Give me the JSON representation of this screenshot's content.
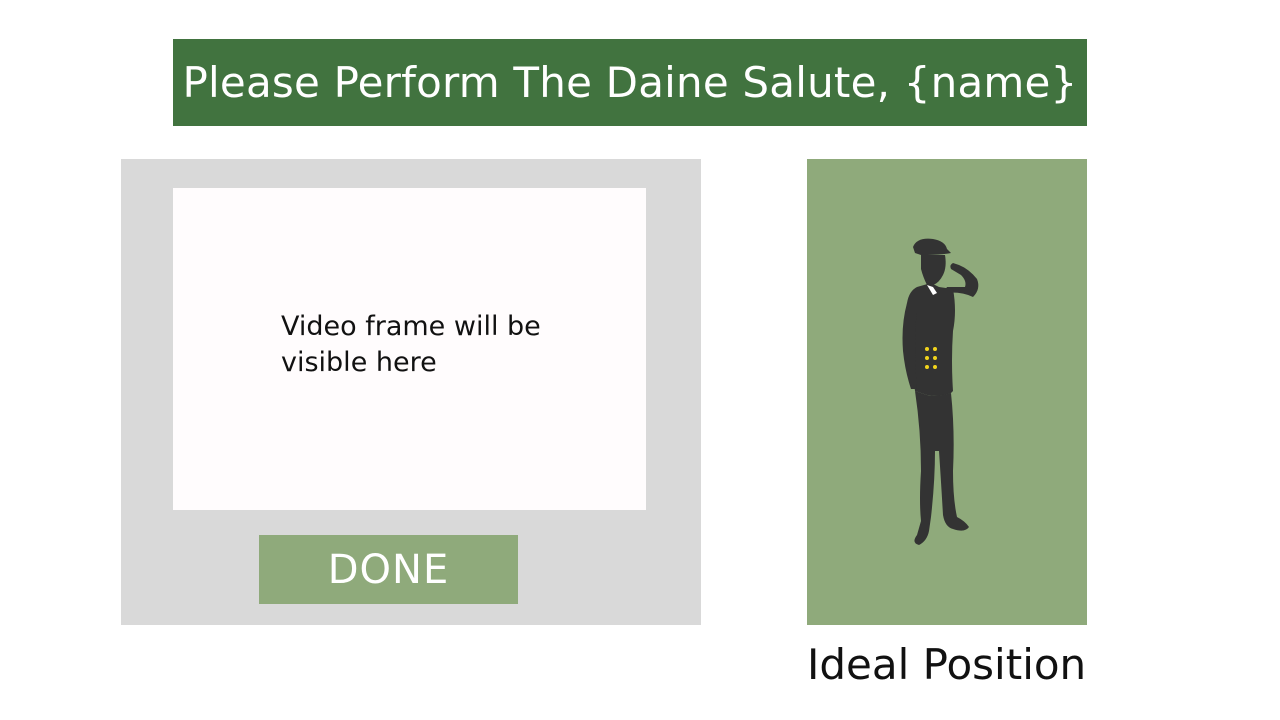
{
  "header": {
    "title": "Please Perform The Daine Salute, {name}"
  },
  "capture": {
    "video_placeholder": "Video frame will be visible here",
    "done_label": "DONE"
  },
  "reference": {
    "label": "Ideal Position",
    "figure_icon": "saluting-soldier-silhouette"
  },
  "colors": {
    "banner": "#41733f",
    "accent_green": "#8faa7b",
    "panel_gray": "#d9d9d9",
    "video_bg": "#fffcfd",
    "silhouette": "#333333",
    "buttons_gold": "#f2d41c"
  }
}
